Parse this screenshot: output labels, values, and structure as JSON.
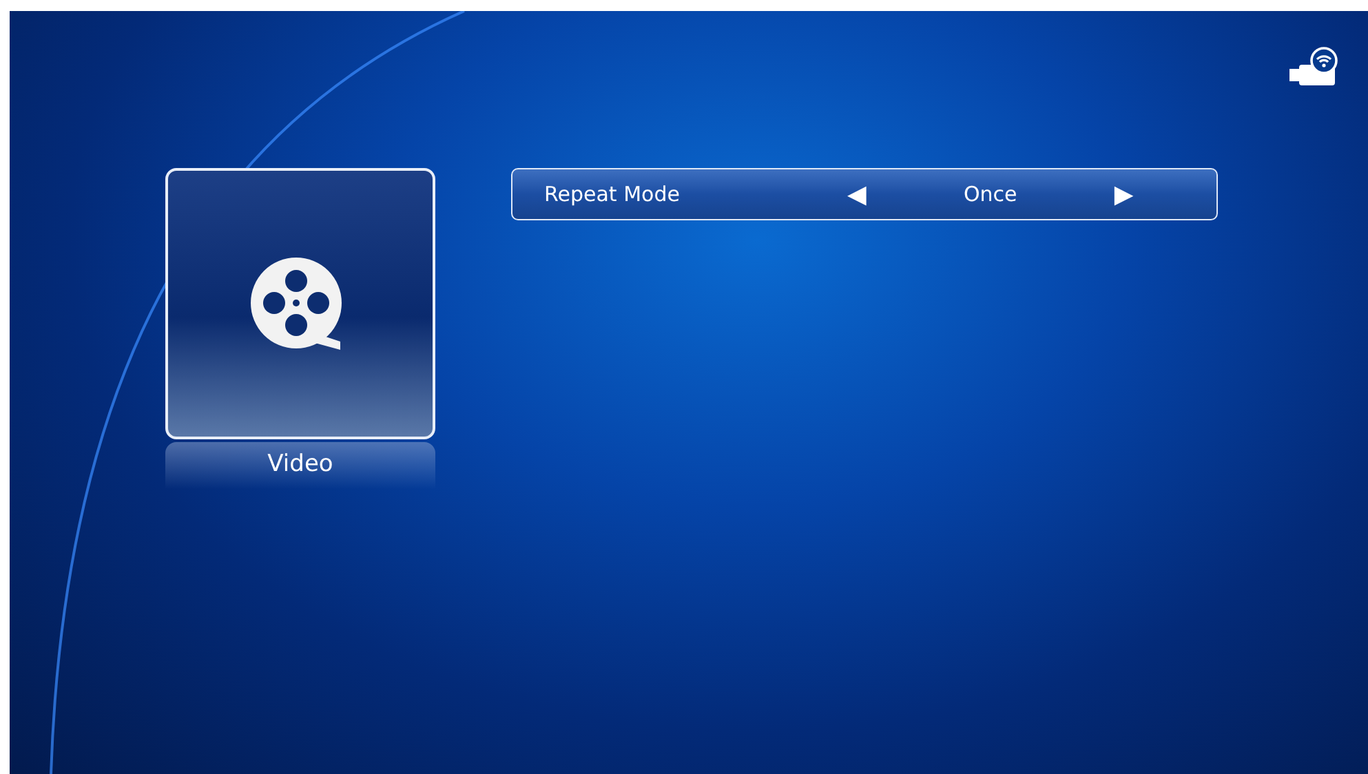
{
  "tile": {
    "label": "Video"
  },
  "setting": {
    "label": "Repeat Mode",
    "prev": "◀",
    "value": "Once",
    "next": "▶"
  }
}
